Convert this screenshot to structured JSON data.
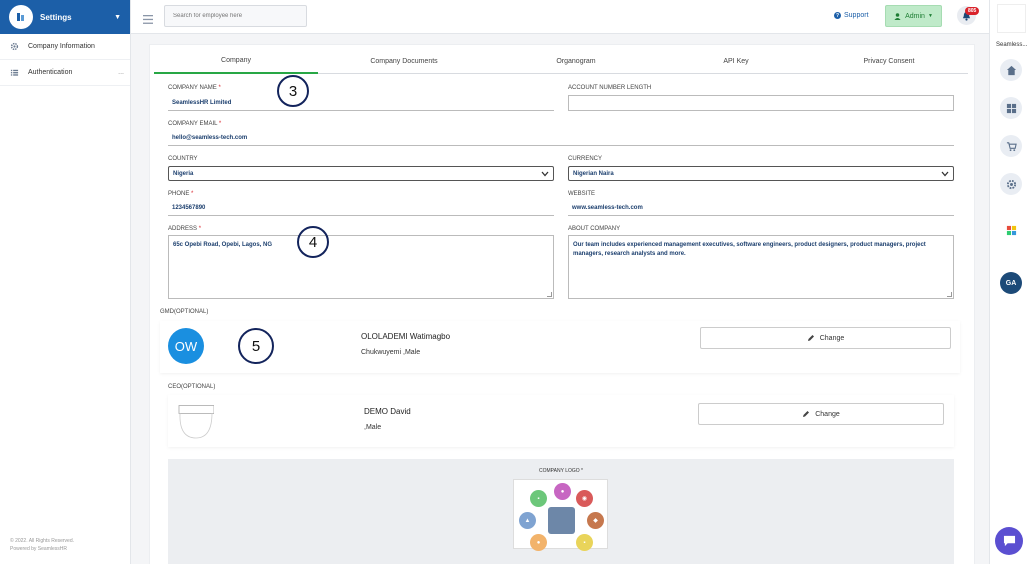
{
  "app": {
    "title": "Settings",
    "footer_line1": "© 2022. All Rights Reserved.",
    "footer_line2": "Powered by SeamlessHR"
  },
  "sidebar": {
    "items": [
      {
        "label": "Company Information",
        "icon": "gear-icon"
      },
      {
        "label": "Authentication",
        "icon": "list-icon",
        "more": "..."
      }
    ]
  },
  "topbar": {
    "search_placeholder": "Search for employee here",
    "support_label": "Support",
    "admin_label": "Admin",
    "notification_count": "805"
  },
  "rail": {
    "label": "Seamless...",
    "user_initials": "GA"
  },
  "tabs": [
    {
      "label": "Company",
      "active": true
    },
    {
      "label": "Company Documents",
      "active": false
    },
    {
      "label": "Organogram",
      "active": false
    },
    {
      "label": "API Key",
      "active": false
    },
    {
      "label": "Privacy Consent",
      "active": false
    }
  ],
  "form": {
    "company_name_label": "COMPANY NAME",
    "company_name": "SeamlessHR Limited",
    "account_number_length_label": "ACCOUNT NUMBER LENGTH",
    "account_number_length": "",
    "company_email_label": "COMPANY EMAIL",
    "company_email": "hello@seamless-tech.com",
    "country_label": "COUNTRY",
    "country": "Nigeria",
    "currency_label": "CURRENCY",
    "currency": "Nigerian Naira",
    "phone_label": "PHONE",
    "phone": "1234567890",
    "website_label": "WEBSITE",
    "website": "www.seamless-tech.com",
    "address_label": "ADDRESS",
    "address": "65c Opebi Road, Opebi, Lagos, NG",
    "about_label": "ABOUT COMPANY",
    "about": "Our team includes experienced management executives, software engineers, product designers, product managers, project managers, research analysts and more.",
    "required_mark": "*"
  },
  "gmd": {
    "section_label": "GMD(OPTIONAL)",
    "initials": "OW",
    "name": "OLOLADEMI Watimagbo",
    "sub": "Chukwuyemi ,Male",
    "change_label": "Change"
  },
  "ceo": {
    "section_label": "CEO(OPTIONAL)",
    "name": "DEMO David",
    "sub": ",Male",
    "change_label": "Change"
  },
  "logo": {
    "label": "COMPANY LOGO *"
  },
  "annotations": [
    "3",
    "4",
    "5"
  ],
  "colors": {
    "brand": "#1c5fa8",
    "accent_green": "#28a745",
    "badge_red": "#d9222a"
  }
}
